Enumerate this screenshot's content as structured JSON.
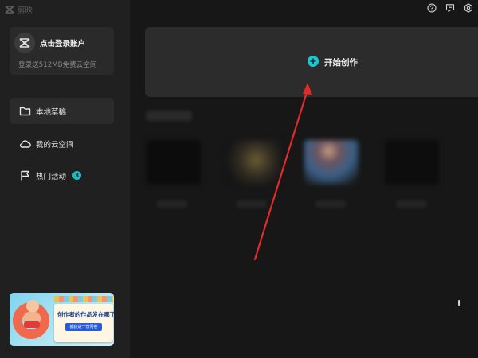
{
  "app": {
    "name": "剪映"
  },
  "login": {
    "title": "点击登录账户",
    "subtitle": "登录送512MB免费云空间"
  },
  "nav": [
    {
      "label": "本地草稿",
      "icon": "folder-icon",
      "active": true
    },
    {
      "label": "我的云空间",
      "icon": "cloud-icon",
      "active": false
    },
    {
      "label": "热门活动",
      "icon": "flag-icon",
      "active": false,
      "badge": "3"
    }
  ],
  "toolbar": {
    "icons": [
      "help-icon",
      "feedback-icon",
      "settings-icon"
    ]
  },
  "main": {
    "create_label": "开始创作"
  },
  "promo": {
    "title": "创作者的作品发在哪了?",
    "button": "捕获进一份问卷"
  },
  "colors": {
    "accent": "#1fc5cf",
    "arrow": "#e02b2b",
    "sidebar": "#202020",
    "background": "#171717"
  }
}
